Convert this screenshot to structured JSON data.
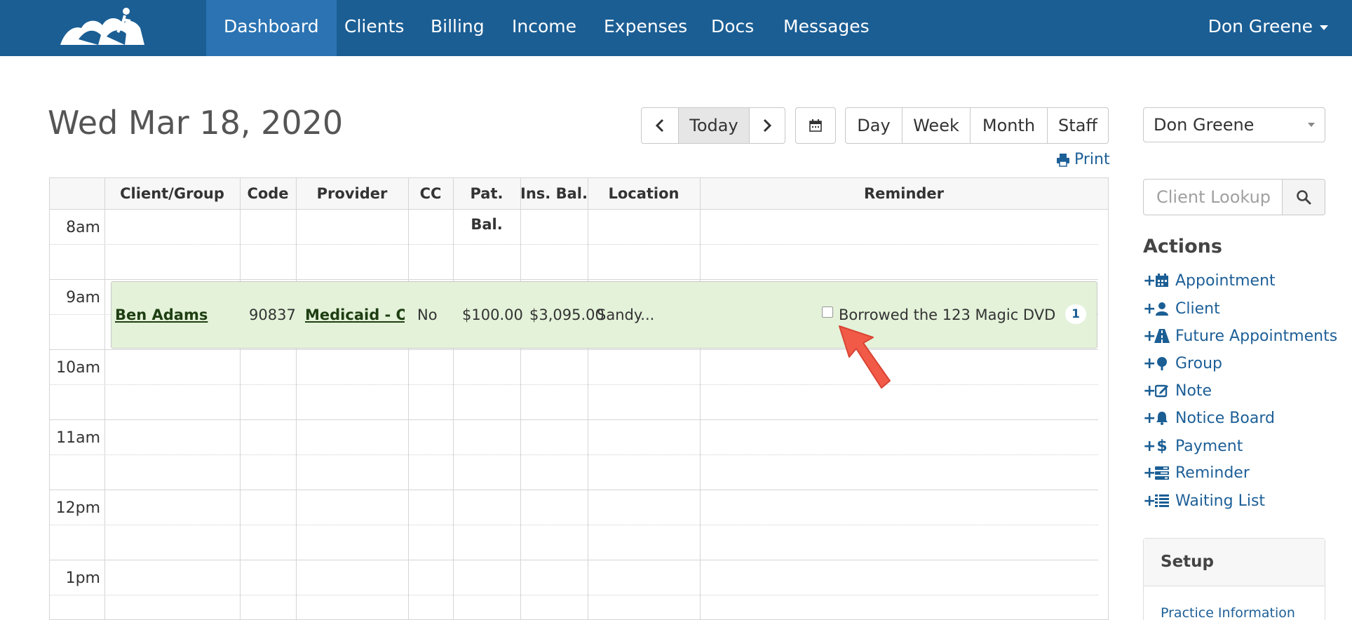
{
  "nav": {
    "items": [
      {
        "label": "Dashboard",
        "active": true
      },
      {
        "label": "Clients"
      },
      {
        "label": "Billing"
      },
      {
        "label": "Income"
      },
      {
        "label": "Expenses"
      },
      {
        "label": "Docs"
      },
      {
        "label": "Messages"
      }
    ],
    "user": "Don Greene",
    "colors": {
      "bar": "#1b5e94",
      "active": "#2b73b2"
    }
  },
  "header": {
    "date": "Wed Mar 18, 2020"
  },
  "toolbar": {
    "prev": "‹",
    "today": "Today",
    "next": "›",
    "views": [
      "Day",
      "Week",
      "Month",
      "Staff"
    ],
    "print": "Print"
  },
  "calendar": {
    "columns": [
      "Client/Group",
      "Code",
      "Provider",
      "CC",
      "Pat. Bal.",
      "Ins. Bal.",
      "Location",
      "Reminder"
    ],
    "times": [
      "8am",
      "9am",
      "10am",
      "11am",
      "12pm",
      "1pm"
    ],
    "appointment": {
      "client": "Ben Adams",
      "code": "90837",
      "provider": "Medicaid - O...",
      "cc": "No",
      "pat_bal": "$100.00",
      "ins_bal": "$3,095.00",
      "location": "Sandy...",
      "reminder": "Borrowed the 123 Magic DVD",
      "count": "1",
      "color": "#e3f2d9"
    }
  },
  "sidebar": {
    "provider_select": "Don Greene",
    "lookup_placeholder": "Client Lookup",
    "actions_title": "Actions",
    "actions": [
      {
        "label": "Appointment",
        "icon": "calendar-icon"
      },
      {
        "label": "Client",
        "icon": "user-icon"
      },
      {
        "label": "Future Appointments",
        "icon": "road-icon"
      },
      {
        "label": "Group",
        "icon": "tree-icon"
      },
      {
        "label": "Note",
        "icon": "edit-icon"
      },
      {
        "label": "Notice Board",
        "icon": "bell-icon"
      },
      {
        "label": "Payment",
        "icon": "dollar-icon"
      },
      {
        "label": "Reminder",
        "icon": "tasks-icon"
      },
      {
        "label": "Waiting List",
        "icon": "list-icon"
      }
    ],
    "setup_title": "Setup",
    "setup_link": "Practice Information"
  }
}
